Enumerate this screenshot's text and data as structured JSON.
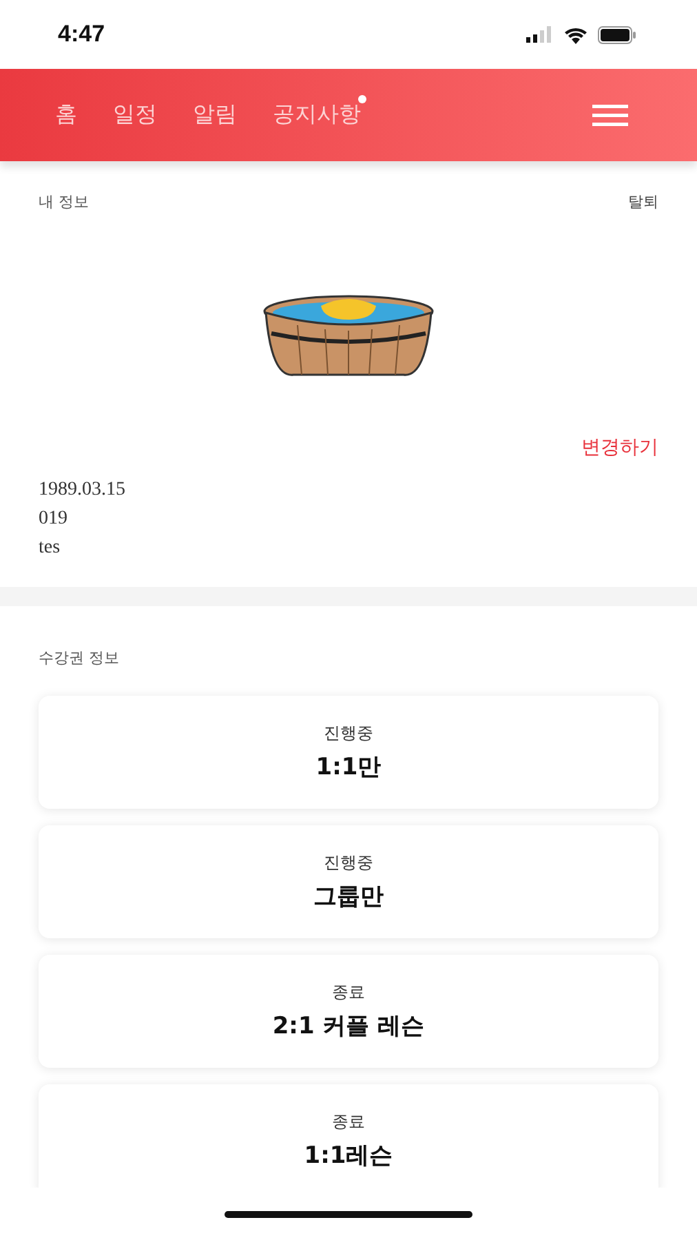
{
  "status_bar": {
    "time": "4:47"
  },
  "nav": {
    "tabs": [
      {
        "label": "홈",
        "badge": false
      },
      {
        "label": "일정",
        "badge": false
      },
      {
        "label": "알림",
        "badge": false
      },
      {
        "label": "공지사항",
        "badge": true
      }
    ]
  },
  "profile": {
    "title": "내 정보",
    "withdraw": "탈퇴",
    "edit": "변경하기",
    "birth": "1989.03.15",
    "phone": "019",
    "email": "tes"
  },
  "tickets": {
    "title": "수강권 정보",
    "items": [
      {
        "status": "진행중",
        "name": "1:1만"
      },
      {
        "status": "진행중",
        "name": "그룹만"
      },
      {
        "status": "종료",
        "name": "2:1 커플 레슨"
      },
      {
        "status": "종료",
        "name": "1:1레슨"
      }
    ]
  }
}
